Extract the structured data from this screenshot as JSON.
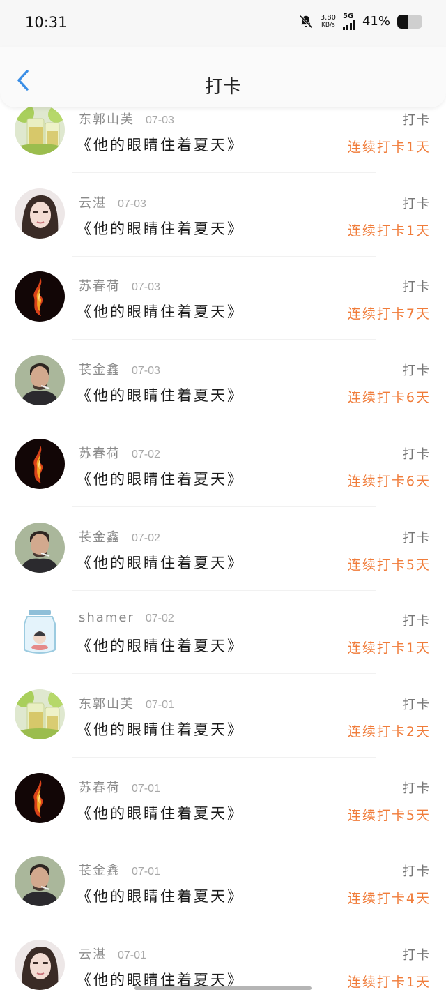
{
  "status_bar": {
    "time": "10:31",
    "net_speed_value": "3.80",
    "net_speed_unit": "KB/s",
    "network": "5G",
    "battery_percent": "41%",
    "battery_level": 0.41,
    "icons": [
      "bell-muted-icon",
      "signal-icon",
      "battery-icon"
    ]
  },
  "header": {
    "title": "打卡",
    "back_icon": "chevron-left-icon",
    "accent_color": "#3a8ee6"
  },
  "streak_color": "#f07c3a",
  "checkins": [
    {
      "name": "东郭山芙",
      "date": "07-03",
      "book": "《他的眼睛住着夏天》",
      "action": "打卡",
      "streak": "连续打卡1天",
      "avatar": "drink-glass-avatar"
    },
    {
      "name": "云湛",
      "date": "07-03",
      "book": "《他的眼睛住着夏天》",
      "action": "打卡",
      "streak": "连续打卡1天",
      "avatar": "woman-portrait-avatar"
    },
    {
      "name": "苏春荷",
      "date": "07-03",
      "book": "《他的眼睛住着夏天》",
      "action": "打卡",
      "streak": "连续打卡7天",
      "avatar": "flame-avatar"
    },
    {
      "name": "苌金鑫",
      "date": "07-03",
      "book": "《他的眼睛住着夏天》",
      "action": "打卡",
      "streak": "连续打卡6天",
      "avatar": "man-portrait-avatar"
    },
    {
      "name": "苏春荷",
      "date": "07-02",
      "book": "《他的眼睛住着夏天》",
      "action": "打卡",
      "streak": "连续打卡6天",
      "avatar": "flame-avatar"
    },
    {
      "name": "苌金鑫",
      "date": "07-02",
      "book": "《他的眼睛住着夏天》",
      "action": "打卡",
      "streak": "连续打卡5天",
      "avatar": "man-portrait-avatar"
    },
    {
      "name": "shamer",
      "date": "07-02",
      "book": "《他的眼睛住着夏天》",
      "action": "打卡",
      "streak": "连续打卡1天",
      "avatar": "jar-avatar"
    },
    {
      "name": "东郭山芙",
      "date": "07-01",
      "book": "《他的眼睛住着夏天》",
      "action": "打卡",
      "streak": "连续打卡2天",
      "avatar": "drink-glass-avatar"
    },
    {
      "name": "苏春荷",
      "date": "07-01",
      "book": "《他的眼睛住着夏天》",
      "action": "打卡",
      "streak": "连续打卡5天",
      "avatar": "flame-avatar"
    },
    {
      "name": "苌金鑫",
      "date": "07-01",
      "book": "《他的眼睛住着夏天》",
      "action": "打卡",
      "streak": "连续打卡4天",
      "avatar": "man-portrait-avatar"
    },
    {
      "name": "云湛",
      "date": "07-01",
      "book": "《他的眼睛住着夏天》",
      "action": "打卡",
      "streak": "连续打卡1天",
      "avatar": "woman-portrait-avatar"
    }
  ]
}
